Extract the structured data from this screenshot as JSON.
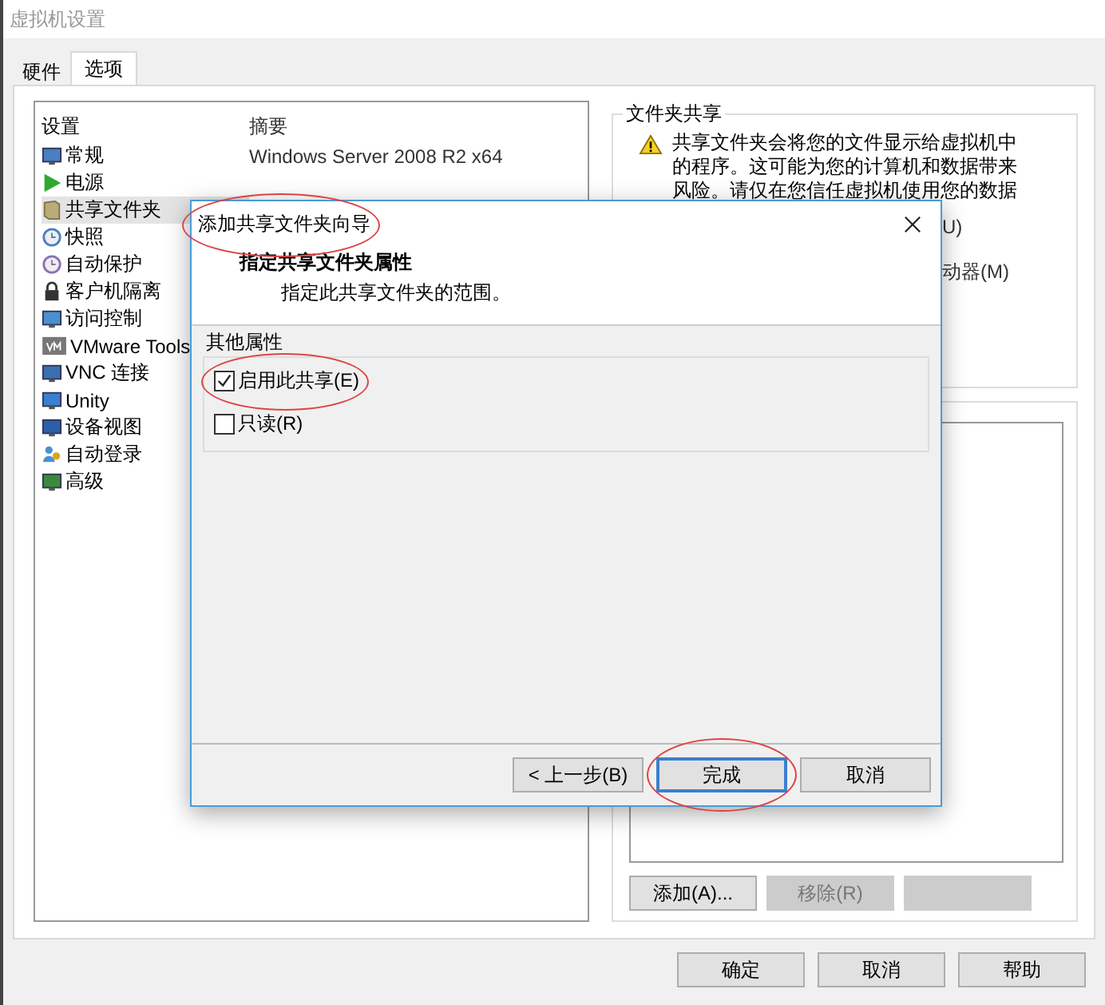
{
  "window": {
    "title": "虚拟机设置"
  },
  "tabs": [
    {
      "label": "硬件",
      "selected": false
    },
    {
      "label": "选项",
      "selected": true
    }
  ],
  "settings_list": {
    "columns": [
      "设置",
      "摘要"
    ],
    "items": [
      {
        "label": "常规",
        "summary": "Windows Server 2008 R2 x64",
        "selected": false
      },
      {
        "label": "电源",
        "selected": false
      },
      {
        "label": "共享文件夹",
        "selected": true
      },
      {
        "label": "快照",
        "selected": false
      },
      {
        "label": "自动保护",
        "selected": false
      },
      {
        "label": "客户机隔离",
        "selected": false
      },
      {
        "label": "访问控制",
        "selected": false
      },
      {
        "label": "VMware Tools",
        "selected": false
      },
      {
        "label": "VNC 连接",
        "selected": false
      },
      {
        "label": "Unity",
        "selected": false
      },
      {
        "label": "设备视图",
        "selected": false
      },
      {
        "label": "自动登录",
        "selected": false
      },
      {
        "label": "高级",
        "selected": false
      }
    ]
  },
  "folder_sharing": {
    "title": "文件夹共享",
    "warning": "共享文件夹会将您的文件显示给虚拟机中的程序。这可能为您的计算机和数据带来风险。请仅在您信任虚拟机使用您的数据",
    "options": [
      "U)",
      "动器(M)"
    ]
  },
  "folders_buttons": [
    {
      "label": "添加(A)...",
      "disabled": false
    },
    {
      "label": "移除(R)",
      "disabled": true
    },
    {
      "disabled": true
    }
  ],
  "footer_buttons": [
    "确定",
    "取消",
    "帮助"
  ],
  "dialog": {
    "title": "添加共享文件夹向导",
    "title_circled": true,
    "heading": "指定共享文件夹属性",
    "subheading": "指定此共享文件夹的范围。",
    "group": "其他属性",
    "checkboxes": [
      {
        "label": "启用此共享(E)",
        "checked": true,
        "circled": true
      },
      {
        "label": "只读(R)",
        "checked": false,
        "circled": false
      }
    ],
    "buttons": [
      {
        "label": "< 上一步(B)",
        "default": false,
        "circled": false
      },
      {
        "label": "完成",
        "default": true,
        "circled": true
      },
      {
        "label": "取消",
        "default": false,
        "circled": false
      }
    ]
  }
}
